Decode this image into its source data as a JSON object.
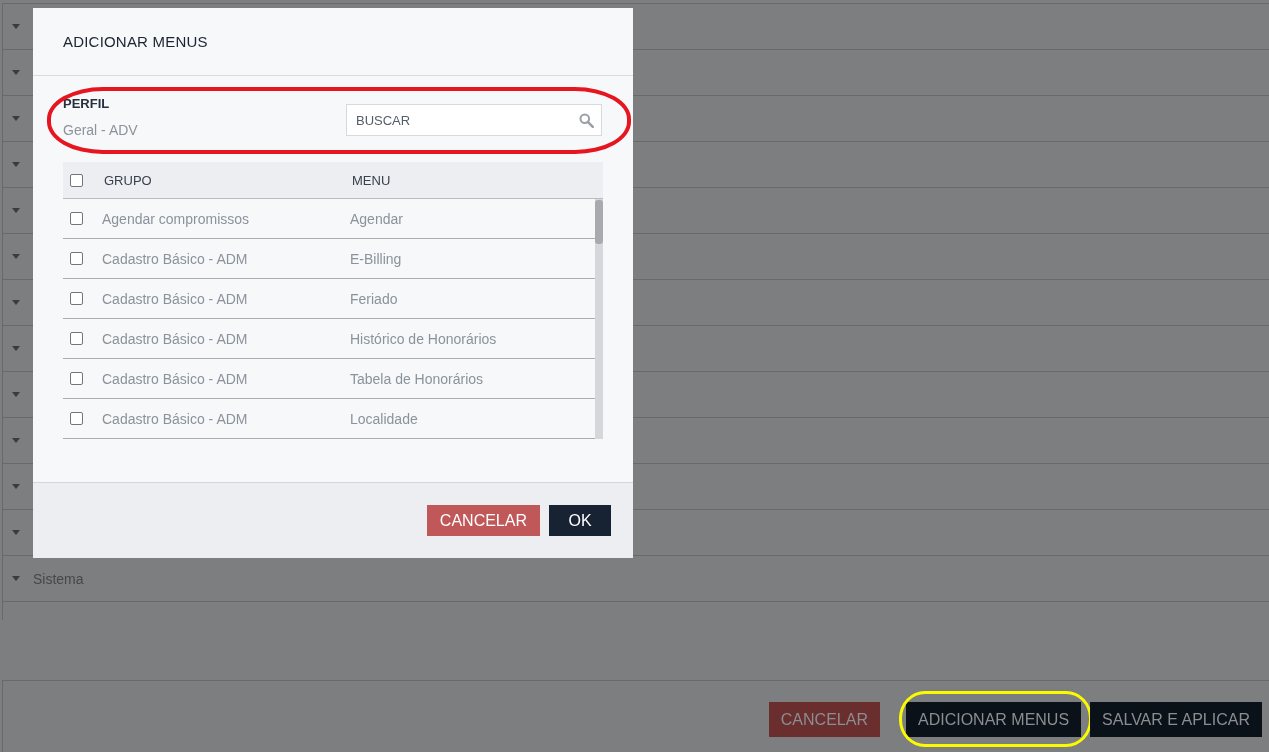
{
  "background": {
    "menu_groups": [
      {
        "kind": "covered"
      },
      {
        "kind": "covered"
      },
      {
        "kind": "covered"
      },
      {
        "kind": "covered"
      },
      {
        "kind": "covered"
      },
      {
        "kind": "covered"
      },
      {
        "kind": "covered"
      },
      {
        "kind": "covered"
      },
      {
        "kind": "covered"
      },
      {
        "kind": "covered"
      },
      {
        "kind": "covered"
      },
      {
        "kind": "covered"
      },
      {
        "kind": "labeled",
        "label": "Sistema"
      }
    ],
    "buttons": [
      {
        "label": "CANCELAR",
        "kind": "danger",
        "highlighted": false
      },
      {
        "label": "ADICIONAR MENUS",
        "kind": "primary",
        "highlighted": true
      },
      {
        "label": "SALVAR E APLICAR",
        "kind": "primary",
        "highlighted": false
      }
    ]
  },
  "modal": {
    "title": "ADICIONAR MENUS",
    "filter": {
      "label": "PERFIL",
      "value": "Geral - ADV",
      "search": {
        "placeholder": "BUSCAR"
      },
      "highlighted": true
    },
    "table": {
      "select_all": {
        "checked": false
      },
      "columns": [
        "GRUPO",
        "MENU"
      ],
      "rows": [
        {
          "checked": false,
          "grupo": "Agendar compromissos",
          "menu": "Agendar"
        },
        {
          "checked": false,
          "grupo": "Cadastro Básico - ADM",
          "menu": "E-Billing"
        },
        {
          "checked": false,
          "grupo": "Cadastro Básico - ADM",
          "menu": "Feriado"
        },
        {
          "checked": false,
          "grupo": "Cadastro Básico - ADM",
          "menu": "Histórico de Honorários"
        },
        {
          "checked": false,
          "grupo": "Cadastro Básico - ADM",
          "menu": "Tabela de Honorários"
        },
        {
          "checked": false,
          "grupo": "Cadastro Básico - ADM",
          "menu": "Localidade"
        }
      ]
    },
    "buttons": [
      {
        "label": "CANCELAR",
        "kind": "danger"
      },
      {
        "label": "OK",
        "kind": "primary"
      }
    ]
  }
}
